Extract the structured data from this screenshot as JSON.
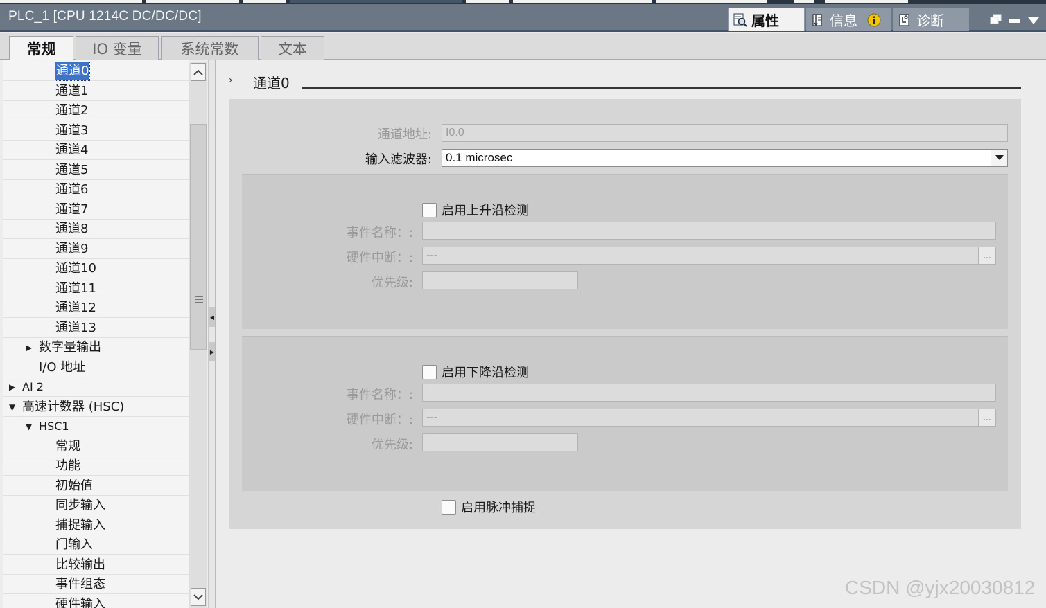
{
  "window": {
    "title": "PLC_1 [CPU 1214C DC/DC/DC]"
  },
  "inspector_tabs": [
    {
      "label": "属性",
      "icon": "properties-magnifier-icon",
      "active": true
    },
    {
      "label": "信息",
      "icon": "info-list-icon",
      "active": false
    },
    {
      "label": "诊断",
      "icon": "diagnostics-icon",
      "active": false
    }
  ],
  "property_tabs": [
    {
      "label": "常规",
      "active": true
    },
    {
      "label": "IO 变量",
      "active": false
    },
    {
      "label": "系统常数",
      "active": false
    },
    {
      "label": "文本",
      "active": false
    }
  ],
  "nav_tree": {
    "items": [
      {
        "label": "通道0",
        "indent": 3,
        "selected": true
      },
      {
        "label": "通道1",
        "indent": 3
      },
      {
        "label": "通道2",
        "indent": 3
      },
      {
        "label": "通道3",
        "indent": 3
      },
      {
        "label": "通道4",
        "indent": 3
      },
      {
        "label": "通道5",
        "indent": 3
      },
      {
        "label": "通道6",
        "indent": 3
      },
      {
        "label": "通道7",
        "indent": 3
      },
      {
        "label": "通道8",
        "indent": 3
      },
      {
        "label": "通道9",
        "indent": 3
      },
      {
        "label": "通道10",
        "indent": 3
      },
      {
        "label": "通道11",
        "indent": 3
      },
      {
        "label": "通道12",
        "indent": 3
      },
      {
        "label": "通道13",
        "indent": 3
      },
      {
        "label": "数字量输出",
        "indent": 2,
        "toggle": "collapsed"
      },
      {
        "label": "I/O 地址",
        "indent": 2
      },
      {
        "label": "AI 2",
        "indent": 1,
        "toggle": "collapsed",
        "small": true
      },
      {
        "label": "高速计数器 (HSC)",
        "indent": 1,
        "toggle": "expanded"
      },
      {
        "label": "HSC1",
        "indent": 2,
        "toggle": "expanded",
        "small": true
      },
      {
        "label": "常规",
        "indent": 3
      },
      {
        "label": "功能",
        "indent": 3
      },
      {
        "label": "初始值",
        "indent": 3
      },
      {
        "label": "同步输入",
        "indent": 3
      },
      {
        "label": "捕捉输入",
        "indent": 3
      },
      {
        "label": "门输入",
        "indent": 3
      },
      {
        "label": "比较输出",
        "indent": 3
      },
      {
        "label": "事件组态",
        "indent": 3
      },
      {
        "label": "硬件输入",
        "indent": 3
      }
    ]
  },
  "section": {
    "title": "通道0"
  },
  "form": {
    "channel_address_label": "通道地址:",
    "channel_address_value": "I0.0",
    "input_filter_label": "输入滤波器:",
    "input_filter_value": "0.1 microsec",
    "rising": {
      "checkbox_label": "启用上升沿检测",
      "event_name_label": "事件名称：:",
      "event_name_value": "",
      "hw_interrupt_label": "硬件中断：:",
      "hw_interrupt_value": "---",
      "ellipsis": "...",
      "priority_label": "优先级:",
      "priority_value": ""
    },
    "falling": {
      "checkbox_label": "启用下降沿检测",
      "event_name_label": "事件名称：:",
      "event_name_value": "",
      "hw_interrupt_label": "硬件中断：:",
      "hw_interrupt_value": "---",
      "ellipsis": "...",
      "priority_label": "优先级:",
      "priority_value": ""
    },
    "pulse_catch_label": "启用脉冲捕捉"
  },
  "watermark": "CSDN @yjx20030812",
  "colors": {
    "title_bar": "#6b7785",
    "selection": "#3c72c8",
    "panel": "#d6d6d6"
  }
}
